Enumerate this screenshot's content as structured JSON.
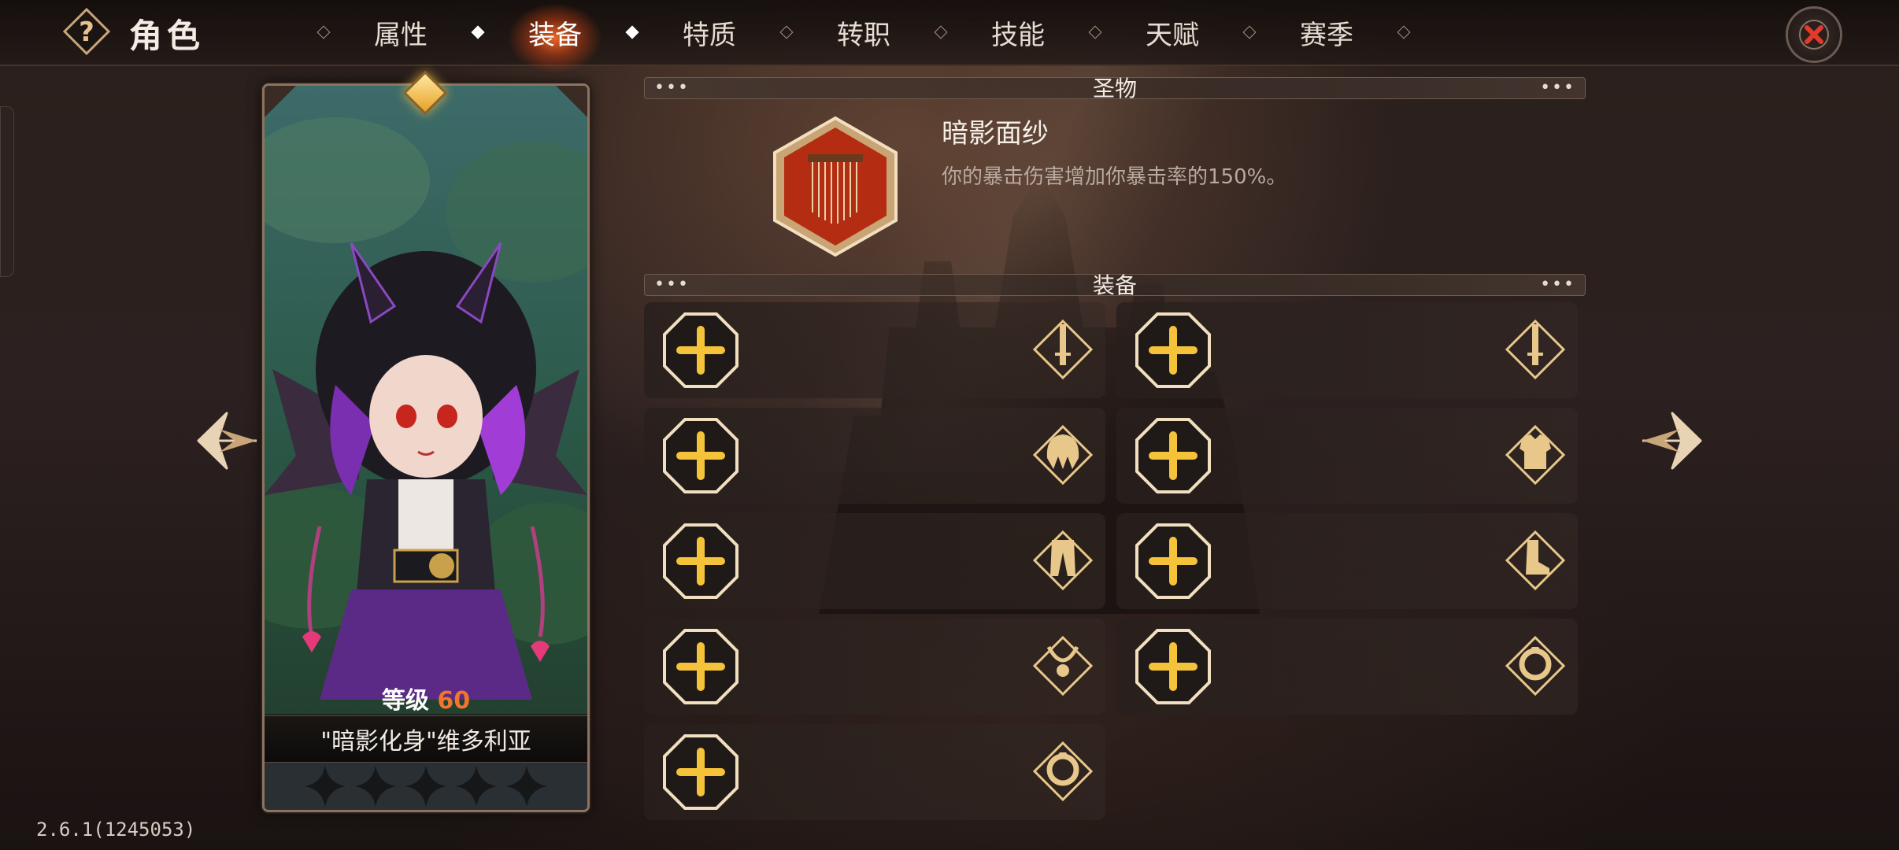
{
  "header": {
    "title": "角色",
    "tabs": [
      {
        "label": "属性",
        "active": false
      },
      {
        "label": "装备",
        "active": true
      },
      {
        "label": "特质",
        "active": false
      },
      {
        "label": "转职",
        "active": false
      },
      {
        "label": "技能",
        "active": false
      },
      {
        "label": "天赋",
        "active": false
      },
      {
        "label": "赛季",
        "active": false
      }
    ]
  },
  "hero": {
    "level_label": "等级",
    "level": "60",
    "name": "\"暗影化身\"维多利亚",
    "stars": 5
  },
  "relic_section": {
    "title": "圣物",
    "item_name": "暗影面纱",
    "item_desc": "你的暴击伤害增加你暴击率的150%。"
  },
  "equipment_section": {
    "title": "装备",
    "slots": [
      {
        "slot": "weapon",
        "icon": "sword-icon"
      },
      {
        "slot": "offhand",
        "icon": "sword-icon"
      },
      {
        "slot": "helmet",
        "icon": "helmet-icon"
      },
      {
        "slot": "armor",
        "icon": "armor-icon"
      },
      {
        "slot": "pants",
        "icon": "pants-icon"
      },
      {
        "slot": "boots",
        "icon": "boots-icon"
      },
      {
        "slot": "necklace",
        "icon": "necklace-icon"
      },
      {
        "slot": "ring",
        "icon": "ring-icon"
      },
      {
        "slot": "ring2",
        "icon": "ring-icon"
      }
    ]
  },
  "version": "2.6.1(1245053)",
  "colors": {
    "accent_orange": "#f2752e",
    "gold": "#e8b84a",
    "close_red": "#e33a2c"
  }
}
